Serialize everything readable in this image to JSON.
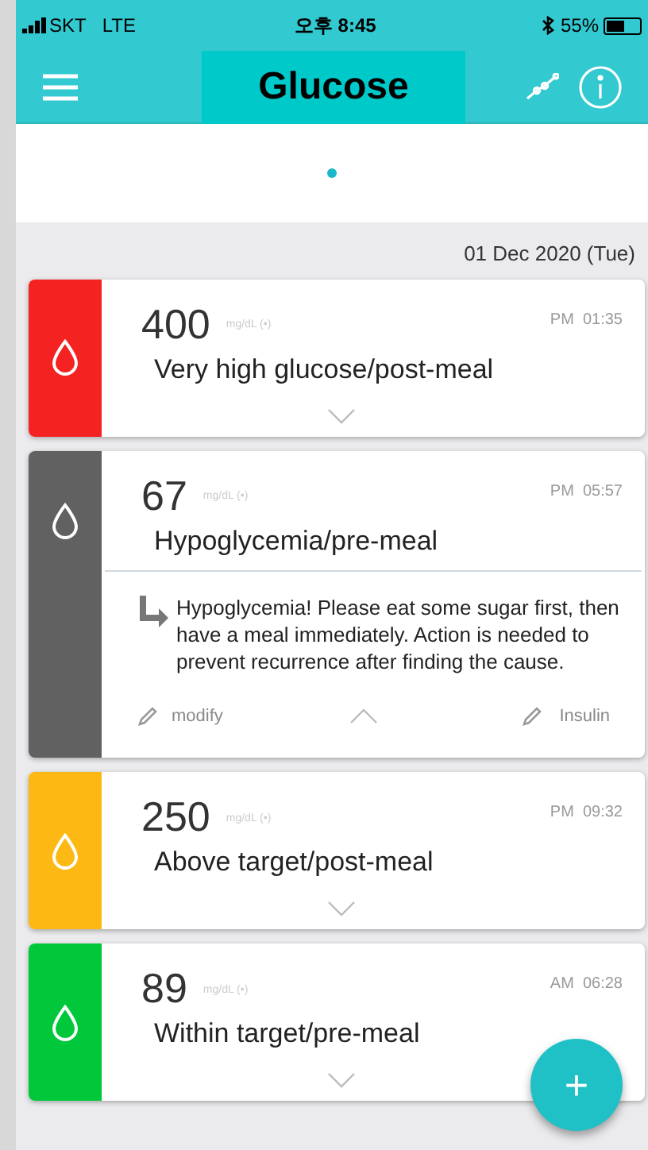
{
  "status_bar": {
    "carrier": "SKT",
    "network": "LTE",
    "time": "오후 8:45",
    "battery": "55%"
  },
  "header": {
    "title": "Glucose"
  },
  "pager": {
    "dots": [
      {
        "selected": true
      }
    ]
  },
  "date": "01 Dec 2020 (Tue)",
  "readings": [
    {
      "value": "400",
      "unit": "mg/dL (•)",
      "time": "PM  01:35",
      "label": "Very high glucose/post-meal",
      "color": "#f52222",
      "expanded": false
    },
    {
      "value": "67",
      "unit": "mg/dL (•)",
      "time": "PM  05:57",
      "label": "Hypoglycemia/pre-meal",
      "color": "#616161",
      "expanded": true,
      "message": "Hypoglycemia! Please eat some sugar first, then have a meal immediately. Action is needed to prevent recurrence after finding the cause.",
      "modify": "modify",
      "insulin": "Insulin"
    },
    {
      "value": "250",
      "unit": "mg/dL (•)",
      "time": "PM  09:32",
      "label": "Above target/post-meal",
      "color": "#fdb813",
      "expanded": false
    },
    {
      "value": "89",
      "unit": "mg/dL (•)",
      "time": "AM  06:28",
      "label": "Within target/pre-meal",
      "color": "#00c83a",
      "expanded": false
    }
  ],
  "fab": {
    "label": "+"
  }
}
